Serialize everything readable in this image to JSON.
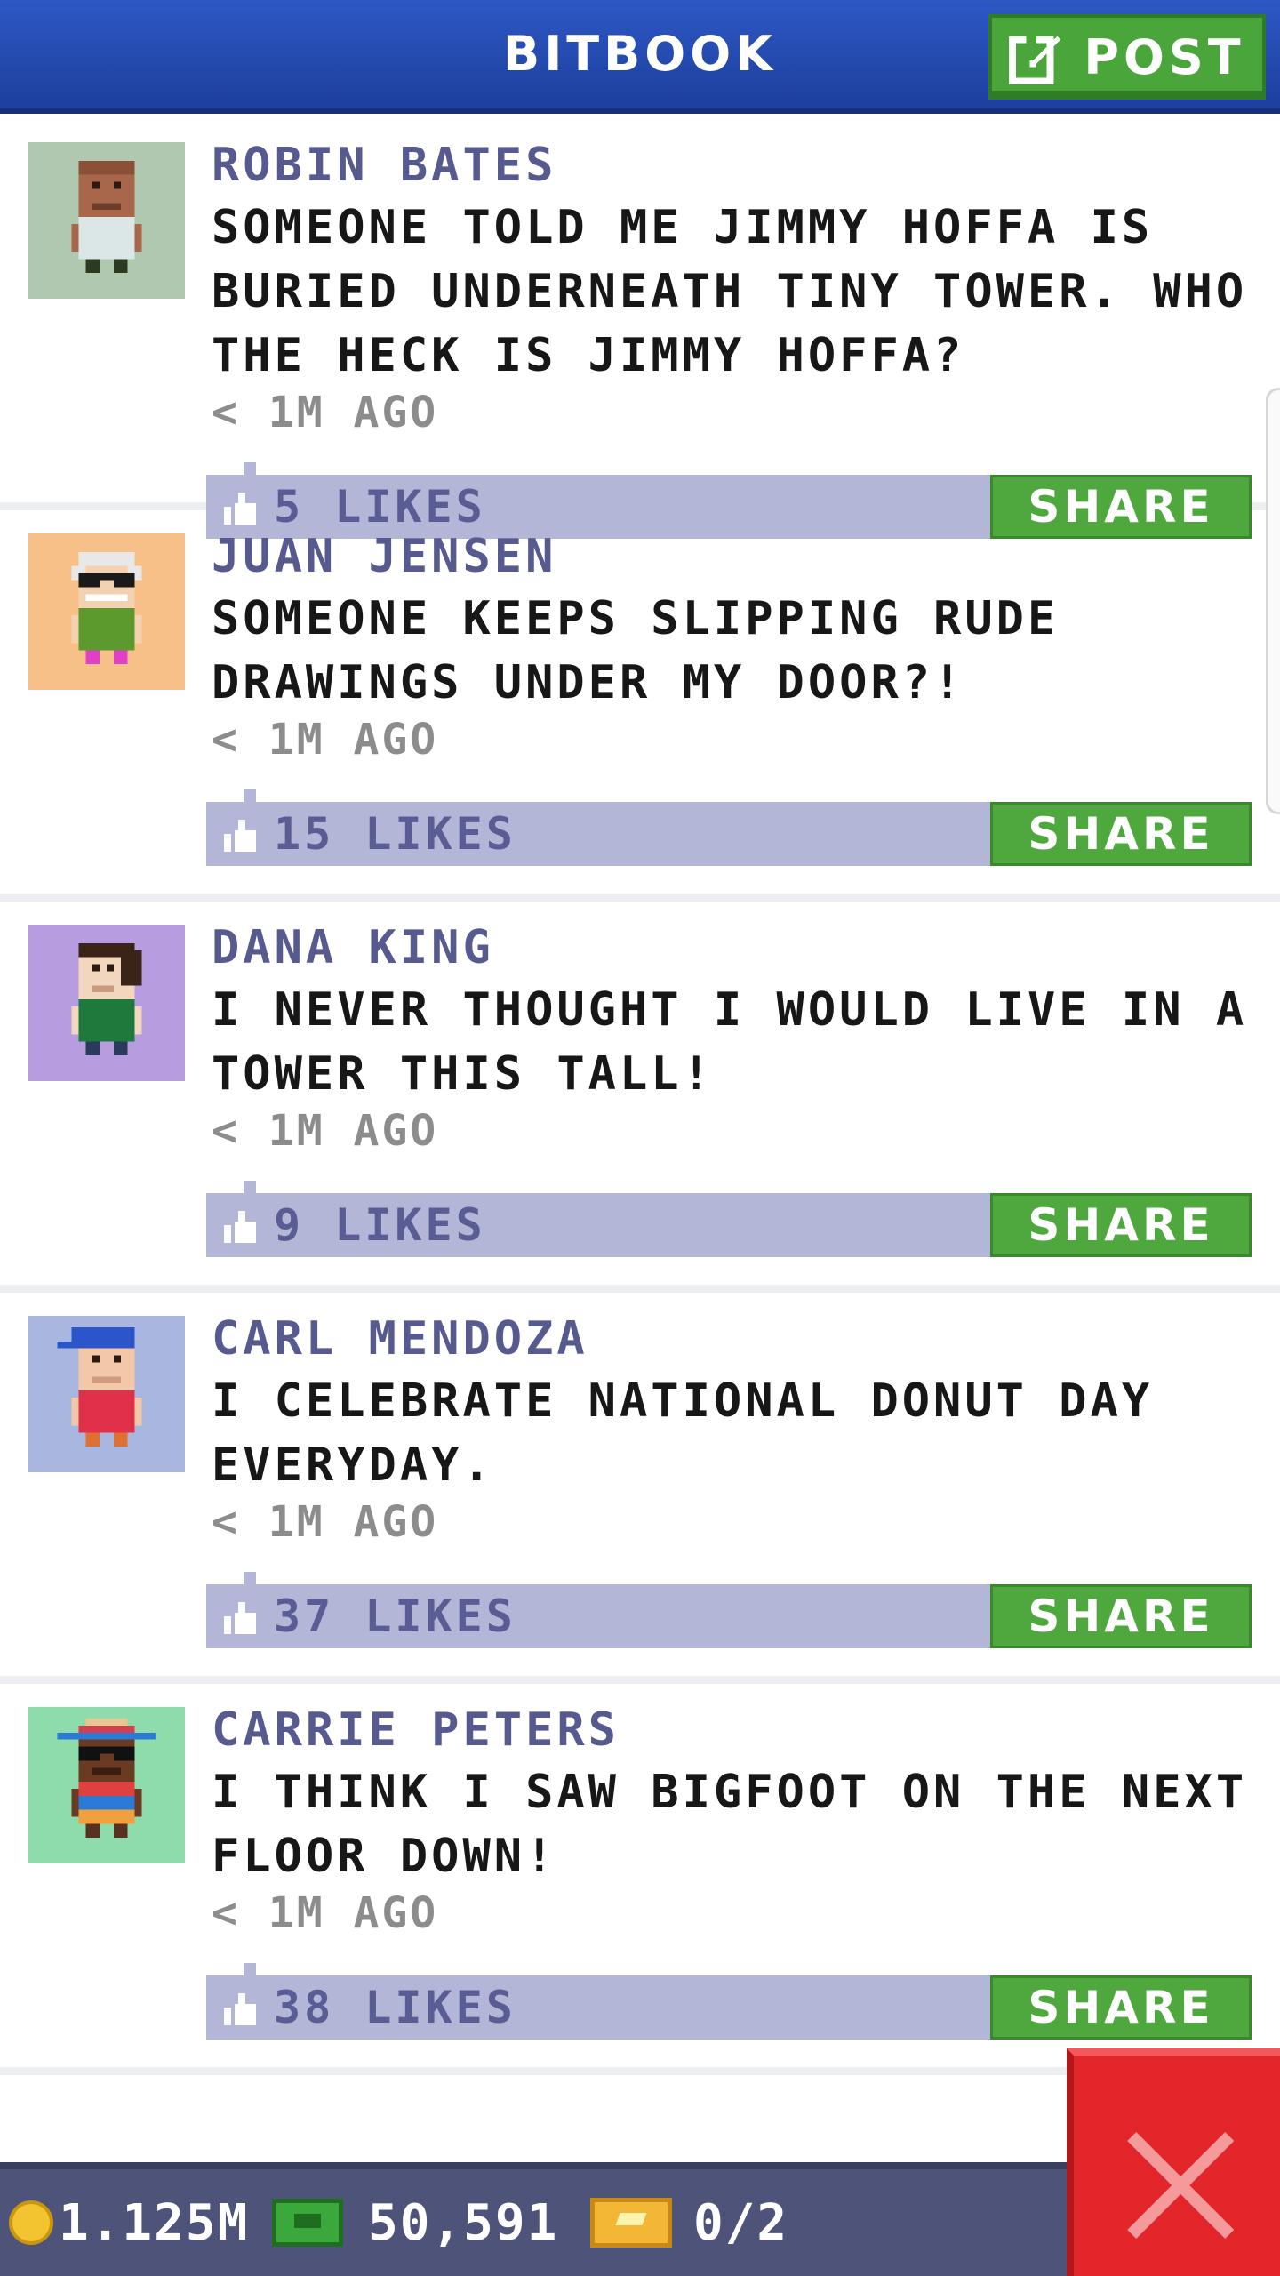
{
  "header": {
    "title": "BITBOOK",
    "post_label": "POST"
  },
  "posts": [
    {
      "author": "ROBIN BATES",
      "message": "SOMEONE TOLD ME JIMMY HOFFA IS BURIED UNDERNEATH TINY TOWER. WHO THE HECK IS JIMMY HOFFA?",
      "time": "< 1M AGO",
      "likes": "5 LIKES",
      "share": "SHARE",
      "avatar_bg": "#b0c8b0"
    },
    {
      "author": "JUAN JENSEN",
      "message": "SOMEONE KEEPS SLIPPING RUDE DRAWINGS UNDER MY DOOR?!",
      "time": "< 1M AGO",
      "likes": "15 LIKES",
      "share": "SHARE",
      "avatar_bg": "#f7c089"
    },
    {
      "author": "DANA KING",
      "message": "I NEVER THOUGHT I WOULD LIVE IN A TOWER THIS TALL!",
      "time": "< 1M AGO",
      "likes": "9 LIKES",
      "share": "SHARE",
      "avatar_bg": "#b79ce0"
    },
    {
      "author": "CARL MENDOZA",
      "message": "I CELEBRATE NATIONAL DONUT DAY EVERYDAY.",
      "time": "< 1M AGO",
      "likes": "37 LIKES",
      "share": "SHARE",
      "avatar_bg": "#a9b6df"
    },
    {
      "author": "CARRIE PETERS",
      "message": "I THINK I SAW BIGFOOT ON THE NEXT FLOOR DOWN!",
      "time": "< 1M AGO",
      "likes": "38 LIKES",
      "share": "SHARE",
      "avatar_bg": "#8edcab"
    }
  ],
  "bottom_bar": {
    "coins": "1.125M",
    "bux": "50,591",
    "tickets": "0/2"
  },
  "colors": {
    "header": "#2d58c4",
    "share_green": "#4fa83d",
    "likes_bar": "#b3b6d6",
    "close_red": "#e3262a"
  }
}
